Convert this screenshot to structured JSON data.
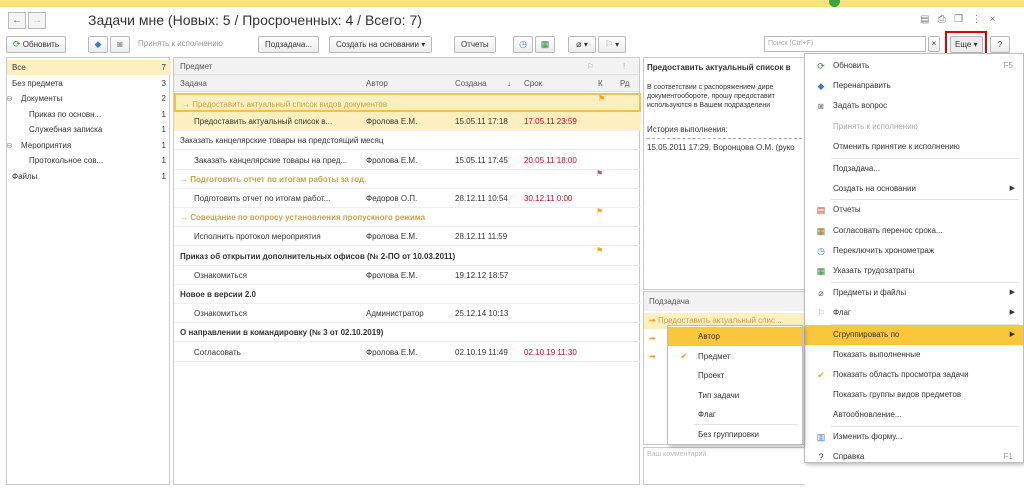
{
  "window": {
    "title": "Задачи мне (Новых: 5 / Просроченных: 4 / Всего: 7)"
  },
  "toolbar": {
    "refresh": "Обновить",
    "accept": "Принять к исполнению",
    "subtask": "Подзадача...",
    "create_based": "Создать на основании",
    "reports": "Отчеты",
    "more": "Еще",
    "help": "?",
    "search_placeholder": "Поиск (Ctrl+F)",
    "search_clear": "×"
  },
  "sidebar": {
    "items": [
      {
        "label": "Все",
        "count": "7"
      },
      {
        "label": "Без предмета",
        "count": "3"
      },
      {
        "label": "Документы",
        "count": "2"
      },
      {
        "label": "Приказ по основн...",
        "count": "1"
      },
      {
        "label": "Служебная записка",
        "count": "1"
      },
      {
        "label": "Мероприятия",
        "count": "1"
      },
      {
        "label": "Протокольное сов...",
        "count": "1"
      },
      {
        "label": "Файлы",
        "count": "1"
      }
    ]
  },
  "table": {
    "header": {
      "subject": "Предмет",
      "task": "Задача",
      "author": "Автор",
      "created": "Создана",
      "due": "Срок",
      "k": "К",
      "pd": "Рд",
      "sort": "↓"
    },
    "rows": [
      {
        "type": "group",
        "task": "→ Предоставить актуальный список видов документов"
      },
      {
        "type": "item",
        "task": "Предоставить актуальный список в...",
        "author": "Фролова Е.М.",
        "created": "15.05.11 17:18",
        "due": "17.05.11 23:59"
      },
      {
        "type": "item",
        "task": "Заказать канцелярские товары на предстоящий месяц",
        "author": "",
        "created": "",
        "due": ""
      },
      {
        "type": "item",
        "task": "Заказать канцелярские товары на пред...",
        "author": "Фролова Е.М.",
        "created": "15.05.11 17:45",
        "due": "20.05.11 18:00"
      },
      {
        "type": "group",
        "task": "→ Подготовить отчет по итогам работы за год."
      },
      {
        "type": "item",
        "task": "Подготовить отчет по итогам работ...",
        "author": "Федоров О.П.",
        "created": "28.12.11 10:54",
        "due": "30.12.11 0:00"
      },
      {
        "type": "group",
        "task": "→ Совещание по вопросу установления пропускного режима"
      },
      {
        "type": "item",
        "task": "Исполнить протокол мероприятия",
        "author": "Фролова Е.М.",
        "created": "28.12.11 11:59",
        "due": ""
      },
      {
        "type": "group",
        "task": "Приказ об открытии дополнительных офисов (№ 2-ПО от 10.03.2011)"
      },
      {
        "type": "item",
        "task": "Ознакомиться",
        "author": "Фролова Е.М.",
        "created": "19.12.12 18:57",
        "due": ""
      },
      {
        "type": "group",
        "task": "Новое в версии 2.0"
      },
      {
        "type": "item",
        "task": "Ознакомиться",
        "author": "Администратор",
        "created": "25.12.14 10:13",
        "due": ""
      },
      {
        "type": "group",
        "task": "О направлении в командировку (№ 3 от 02.10.2019)"
      },
      {
        "type": "item",
        "task": "Согласовать",
        "author": "Фролова Е.М.",
        "created": "02.10.19 11:49",
        "due": "02.10.19 11:30"
      }
    ]
  },
  "preview": {
    "title": "Предоставить актуальный список в",
    "line1": "В соответствии с распоряжением дире",
    "line2": "документообороте, прошу предоставит",
    "line3": "используются в Вашем подразделени",
    "history_label": "История выполнения:",
    "history_entry": "15.05.2011 17:29, Воронцова О.М. (руко",
    "subtask_header": "Подзадача",
    "subtask_row": "Предоставить актуальный спис...",
    "comment_placeholder": "Ваш комментарий"
  },
  "more_menu": {
    "items": [
      {
        "icon": "refresh-icon",
        "label": "Обновить",
        "shortcut": "F5"
      },
      {
        "icon": "redirect-icon",
        "label": "Перенаправить"
      },
      {
        "icon": "question-icon",
        "label": "Задать вопрос"
      },
      {
        "icon": "",
        "label": "Принять к исполнению",
        "disabled": true
      },
      {
        "icon": "",
        "label": "Отменить принятие к исполнению"
      },
      {
        "icon": "",
        "label": "Подзадача..."
      },
      {
        "icon": "",
        "label": "Создать на основании",
        "submenu": true
      },
      {
        "icon": "report-icon",
        "label": "Отчеты"
      },
      {
        "icon": "calendar-icon",
        "label": "Согласовать перенос срока..."
      },
      {
        "icon": "clock-icon",
        "label": "Переключить хронометраж"
      },
      {
        "icon": "labor-icon",
        "label": "Указать трудозатраты"
      },
      {
        "icon": "clip-icon",
        "label": "Предметы и файлы",
        "submenu": true
      },
      {
        "icon": "flag-icon",
        "label": "Флаг",
        "submenu": true
      },
      {
        "icon": "",
        "label": "Сгруппировать по",
        "submenu": true,
        "active": true
      },
      {
        "icon": "",
        "label": "Показать выполненные"
      },
      {
        "icon": "check-icon",
        "label": "Показать область просмотра задачи"
      },
      {
        "icon": "",
        "label": "Показать группы видов предметов"
      },
      {
        "icon": "",
        "label": "Автообновление..."
      },
      {
        "icon": "form-icon",
        "label": "Изменить форму..."
      },
      {
        "icon": "help-icon",
        "label": "Справка",
        "shortcut": "F1"
      }
    ]
  },
  "group_menu": {
    "items": [
      {
        "label": "Автор",
        "active": true
      },
      {
        "label": "Предмет",
        "checked": true
      },
      {
        "label": "Проект"
      },
      {
        "label": "Тип задачи"
      },
      {
        "label": "Флаг"
      },
      {
        "label": "Без группировки"
      }
    ]
  },
  "colors": {
    "selection": "#fdefc0",
    "active_menu": "#f8c73b",
    "group_gold": "#c8a24a",
    "overdue": "#d9001b",
    "highlight_border": "#e00000"
  }
}
